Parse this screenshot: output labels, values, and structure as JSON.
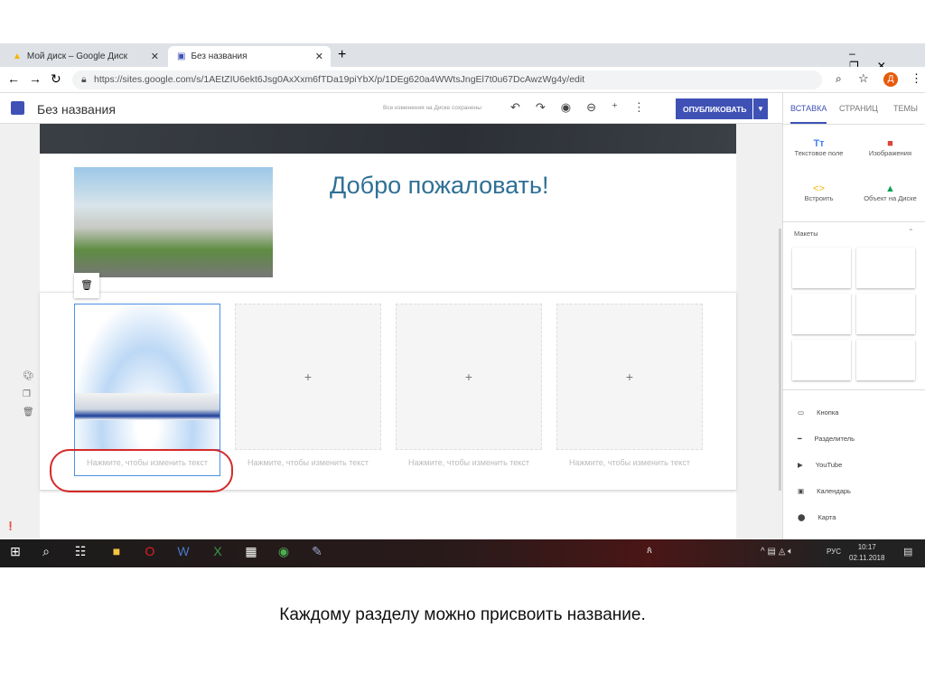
{
  "browser": {
    "tabs": [
      {
        "label": "Мой диск – Google Диск"
      },
      {
        "label": "Без названия"
      }
    ],
    "url": "https://sites.google.com/s/1AEtZIU6ekt6Jsg0AxXxm6fTDa19piYbX/p/1DEg620a4WWtsJngEl7t0u67DcAwzWg4y/edit",
    "profile_initial": "Д"
  },
  "app": {
    "title": "Без названия",
    "save_status": "Все изменения на Диске сохранены",
    "publish_label": "ОПУБЛИКОВАТЬ"
  },
  "page": {
    "heading": "Добро пожаловать!",
    "placeholder_text": "Нажмите, чтобы изменить текст",
    "add_symbol": "+"
  },
  "panel": {
    "tabs": [
      "ВСТАВКА",
      "СТРАНИЦ",
      "ТЕМЫ"
    ],
    "insert": [
      "Текстовое поле",
      "Изображения",
      "Встроить",
      "Объект на Диске"
    ],
    "layouts_label": "Макеты",
    "items": [
      "Кнопка",
      "Разделитель",
      "YouTube",
      "Календарь",
      "Карта"
    ]
  },
  "taskbar": {
    "lang": "РУС",
    "time": "10:17",
    "date": "02.11.2018"
  },
  "caption": "Каждому разделу можно присвоить название."
}
